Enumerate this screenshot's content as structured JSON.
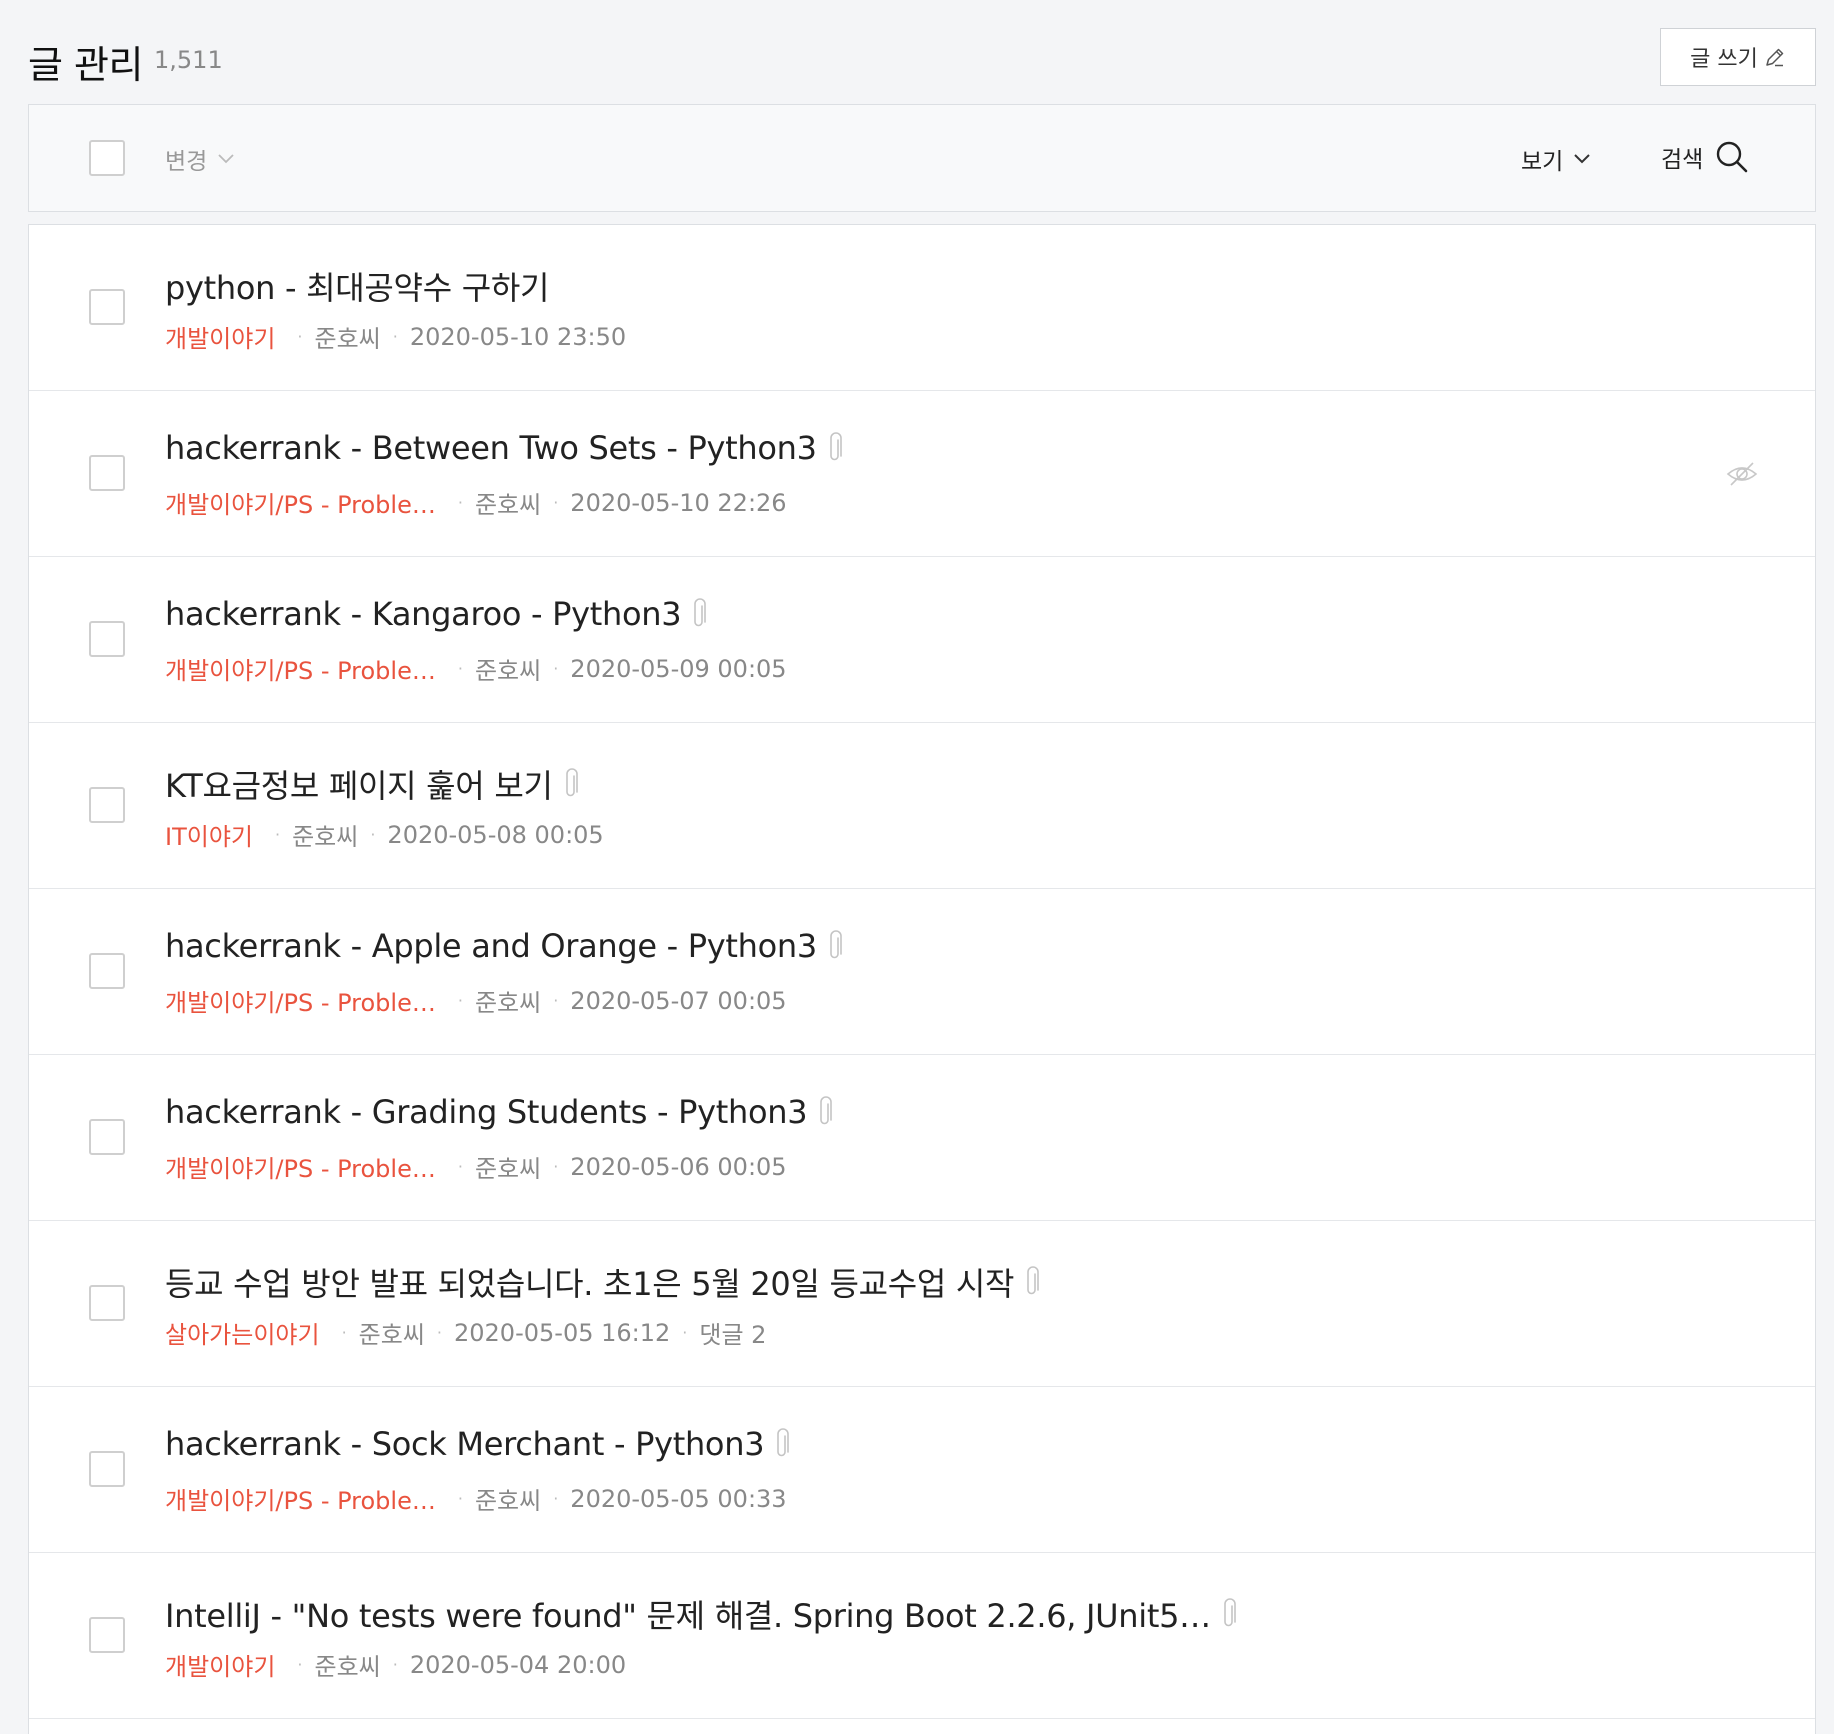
{
  "header": {
    "title": "글 관리",
    "count": "1,511",
    "write_label": "글 쓰기"
  },
  "toolbar": {
    "change_label": "변경",
    "view_label": "보기",
    "search_label": "검색"
  },
  "colors": {
    "category": "#e9533e",
    "background": "#f4f5f7"
  },
  "posts": [
    {
      "title": "python - 최대공약수 구하기",
      "category": "개발이야기",
      "author": "준호씨",
      "date": "2020-05-10 23:50",
      "comments": "",
      "attachment": false,
      "private": false
    },
    {
      "title": "hackerrank - Between Two Sets - Python3",
      "category": "개발이야기/PS - Proble…",
      "author": "준호씨",
      "date": "2020-05-10 22:26",
      "comments": "",
      "attachment": true,
      "private": true
    },
    {
      "title": "hackerrank - Kangaroo - Python3",
      "category": "개발이야기/PS - Proble…",
      "author": "준호씨",
      "date": "2020-05-09 00:05",
      "comments": "",
      "attachment": true,
      "private": false
    },
    {
      "title": "KT요금정보 페이지 훑어 보기",
      "category": "IT이야기",
      "author": "준호씨",
      "date": "2020-05-08 00:05",
      "comments": "",
      "attachment": true,
      "private": false
    },
    {
      "title": "hackerrank - Apple and Orange - Python3",
      "category": "개발이야기/PS - Proble…",
      "author": "준호씨",
      "date": "2020-05-07 00:05",
      "comments": "",
      "attachment": true,
      "private": false
    },
    {
      "title": "hackerrank - Grading Students - Python3",
      "category": "개발이야기/PS - Proble…",
      "author": "준호씨",
      "date": "2020-05-06 00:05",
      "comments": "",
      "attachment": true,
      "private": false
    },
    {
      "title": "등교 수업 방안 발표 되었습니다. 초1은 5월 20일 등교수업 시작",
      "category": "살아가는이야기",
      "author": "준호씨",
      "date": "2020-05-05 16:12",
      "comments": "댓글 2",
      "attachment": true,
      "private": false
    },
    {
      "title": "hackerrank - Sock Merchant - Python3",
      "category": "개발이야기/PS - Proble…",
      "author": "준호씨",
      "date": "2020-05-05 00:33",
      "comments": "",
      "attachment": true,
      "private": false
    },
    {
      "title": "IntelliJ - \"No tests were found\" 문제 해결. Spring Boot 2.2.6, JUnit5…",
      "category": "개발이야기",
      "author": "준호씨",
      "date": "2020-05-04 20:00",
      "comments": "",
      "attachment": true,
      "private": false
    }
  ]
}
